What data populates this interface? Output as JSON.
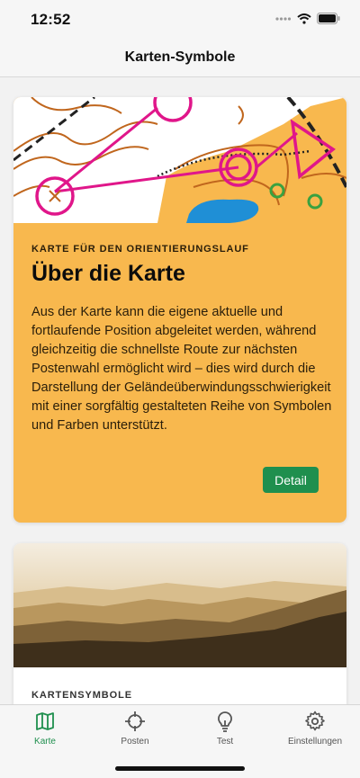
{
  "status_bar": {
    "time": "12:52",
    "icons": [
      "signal-dots-icon",
      "wifi-icon",
      "battery-icon"
    ]
  },
  "nav": {
    "title": "Karten-Symbole"
  },
  "cards": [
    {
      "overline": "KARTE FÜR DEN ORIENTIERUNGSLAUF",
      "title": "Über die Karte",
      "body": "Aus der Karte kann die eigene aktuelle und fortlaufende Position abgeleitet werden, während gleichzeitig die schnellste Route zur nächsten Postenwahl ermöglicht wird – dies wird durch die Darstellung der Geländeüberwindungsschwierigkeit mit einer sorgfältig gestalteten Reihe von Symbolen und Farben unterstützt.",
      "button_label": "Detail",
      "background": "#f8b84e"
    },
    {
      "overline": "KARTENSYMBOLE"
    }
  ],
  "tabs": [
    {
      "label": "Karte",
      "icon": "map-icon",
      "active": true
    },
    {
      "label": "Posten",
      "icon": "crosshair-icon",
      "active": false
    },
    {
      "label": "Test",
      "icon": "lightbulb-icon",
      "active": false
    },
    {
      "label": "Einstellungen",
      "icon": "gear-icon",
      "active": false
    }
  ],
  "colors": {
    "accent": "#1f8f4e",
    "card_orange": "#f8b84e",
    "course_magenta": "#e0168a",
    "contour_brown": "#c0661d",
    "water_blue": "#1f8fd6"
  }
}
